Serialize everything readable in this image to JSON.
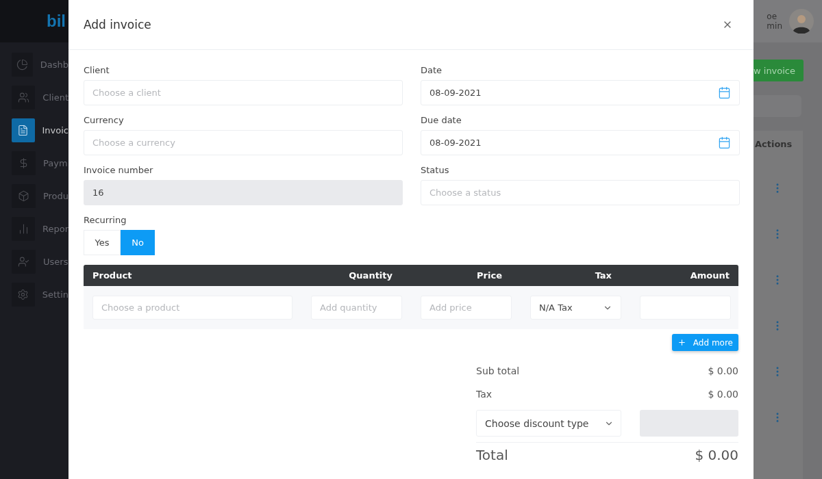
{
  "app": {
    "logo": "bil",
    "sidebar": [
      {
        "label": "Dashb",
        "selected": false
      },
      {
        "label": "Client",
        "selected": false
      },
      {
        "label": "Invoic",
        "selected": true
      },
      {
        "label": "Paym",
        "selected": false
      },
      {
        "label": "Produ",
        "selected": false
      },
      {
        "label": "Repor",
        "selected": false
      },
      {
        "label": "Users",
        "selected": false
      },
      {
        "label": "Settin",
        "selected": false
      }
    ],
    "user": {
      "name": "oe",
      "role": "min"
    },
    "new_button": "w invoice",
    "table_header": "Actions"
  },
  "modal": {
    "title": "Add invoice",
    "fields": [
      {
        "label": "Client",
        "kind": "select",
        "placeholder": "Choose a client"
      },
      {
        "label": "Date",
        "kind": "date",
        "value": "08-09-2021"
      },
      {
        "label": "Currency",
        "kind": "select",
        "placeholder": "Choose a currency"
      },
      {
        "label": "Due date",
        "kind": "date",
        "value": "08-09-2021"
      },
      {
        "label": "Invoice number",
        "kind": "readonly",
        "value": "16"
      },
      {
        "label": "Status",
        "kind": "select",
        "placeholder": "Choose a status"
      }
    ],
    "recurring": {
      "label": "Recurring",
      "options": [
        {
          "label": "Yes",
          "selected": false
        },
        {
          "label": "No",
          "selected": true
        }
      ]
    },
    "items": {
      "columns": [
        "Product",
        "Quantity",
        "Price",
        "Tax",
        "Amount"
      ],
      "row": {
        "product": "Choose a product",
        "quantity": "Add quantity",
        "price": "Add price",
        "tax": "N/A Tax"
      },
      "add_button": "Add more"
    },
    "totals": {
      "sub_total_label": "Sub total",
      "sub_total": "$ 0.00",
      "tax_label": "Tax",
      "tax": "$ 0.00",
      "discount_placeholder": "Choose discount type",
      "total_label": "Total",
      "total": "$ 0.00"
    }
  }
}
